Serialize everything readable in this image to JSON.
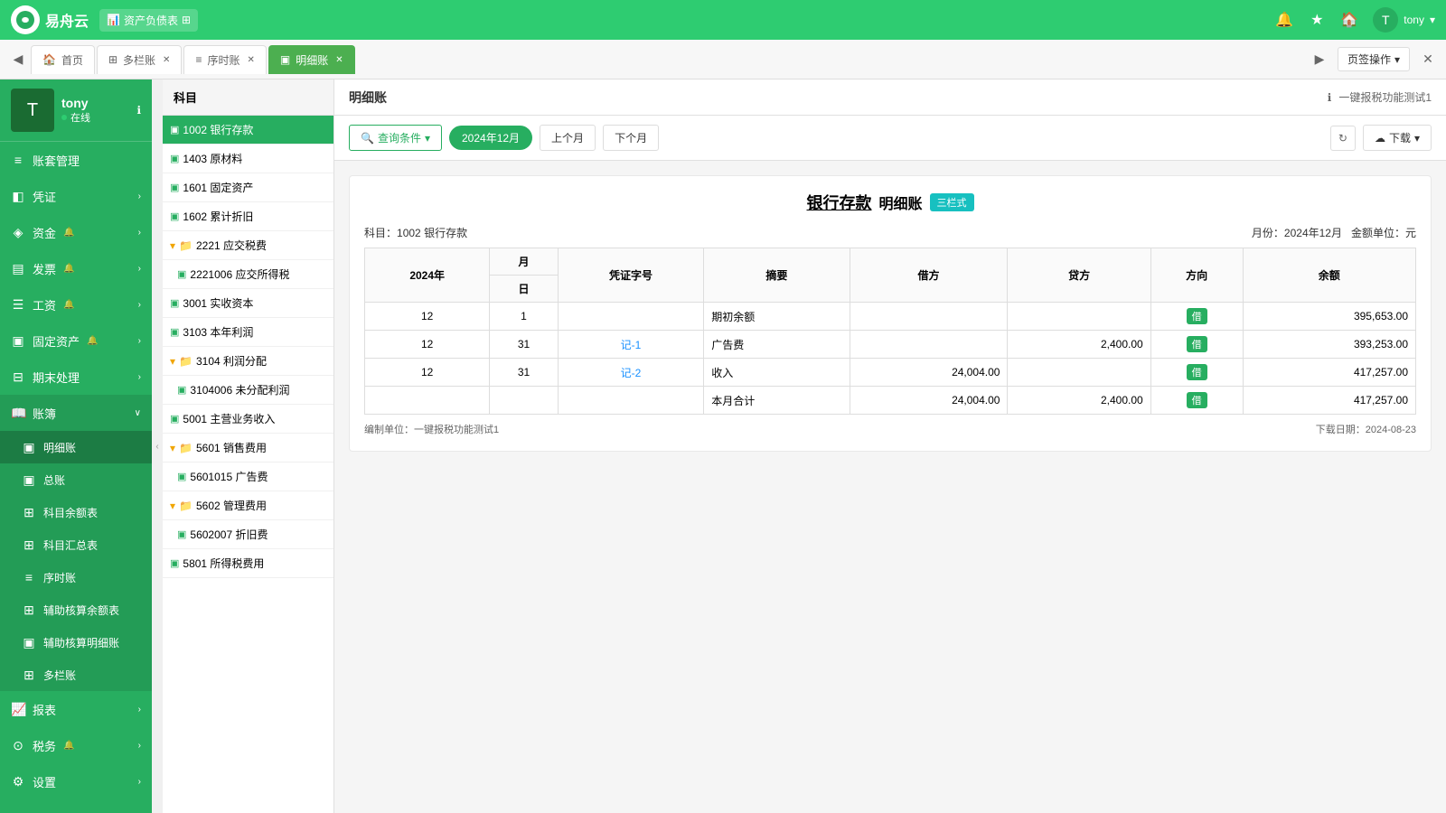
{
  "topbar": {
    "logo_text": "易舟云",
    "breadcrumb": "资产负债表",
    "user": "tony",
    "icons": [
      "bell",
      "star",
      "bookmark",
      "user"
    ]
  },
  "tabs": [
    {
      "id": "home",
      "label": "首页",
      "icon": "🏠",
      "closable": false,
      "active": false
    },
    {
      "id": "multicolumn",
      "label": "多栏账",
      "icon": "⊞",
      "closable": true,
      "active": false
    },
    {
      "id": "sequence",
      "label": "序时账",
      "icon": "≡",
      "closable": true,
      "active": false
    },
    {
      "id": "detail",
      "label": "明细账",
      "icon": "▣",
      "closable": true,
      "active": true
    }
  ],
  "page_action": "页签操作",
  "sidebar": {
    "user": {
      "name": "tony",
      "status": "在线"
    },
    "menu": [
      {
        "id": "accounts",
        "label": "账套管理",
        "icon": "≡",
        "hasArrow": false
      },
      {
        "id": "voucher",
        "label": "凭证",
        "icon": "◧",
        "hasArrow": true
      },
      {
        "id": "capital",
        "label": "资金",
        "icon": "◈",
        "hasArrow": true
      },
      {
        "id": "invoice",
        "label": "发票",
        "icon": "▤",
        "hasArrow": true
      },
      {
        "id": "salary",
        "label": "工资",
        "icon": "☰",
        "hasArrow": true
      },
      {
        "id": "assets",
        "label": "固定资产",
        "icon": "▣",
        "hasArrow": true
      },
      {
        "id": "period",
        "label": "期末处理",
        "icon": "⊟",
        "hasArrow": true
      },
      {
        "id": "ledger",
        "label": "账簿",
        "icon": "📖",
        "hasArrow": false,
        "open": true
      },
      {
        "id": "report",
        "label": "报表",
        "icon": "📈",
        "hasArrow": true
      },
      {
        "id": "tax",
        "label": "税务",
        "icon": "⊙",
        "hasArrow": true
      },
      {
        "id": "settings",
        "label": "设置",
        "icon": "⚙",
        "hasArrow": true
      }
    ],
    "submenu": [
      {
        "id": "detail_ledger",
        "label": "明细账",
        "active": true
      },
      {
        "id": "general_ledger",
        "label": "总账"
      },
      {
        "id": "balance_subject",
        "label": "科目余额表"
      },
      {
        "id": "subject_summary",
        "label": "科目汇总表"
      },
      {
        "id": "journal",
        "label": "序时账"
      },
      {
        "id": "aux_balance",
        "label": "辅助核算余额表"
      },
      {
        "id": "aux_detail",
        "label": "辅助核算明细账"
      },
      {
        "id": "multi_col",
        "label": "多栏账"
      }
    ]
  },
  "subject_panel": {
    "header": "科目",
    "items": [
      {
        "code": "1002",
        "name": "银行存款",
        "level": 0,
        "active": true
      },
      {
        "code": "1403",
        "name": "原材料",
        "level": 0,
        "active": false
      },
      {
        "code": "1601",
        "name": "固定资产",
        "level": 0,
        "active": false
      },
      {
        "code": "1602",
        "name": "累计折旧",
        "level": 0,
        "active": false
      },
      {
        "code": "2221",
        "name": "应交税费",
        "level": 0,
        "folder": true,
        "active": false
      },
      {
        "code": "2221006",
        "name": "应交所得税",
        "level": 1,
        "active": false
      },
      {
        "code": "3001",
        "name": "实收资本",
        "level": 0,
        "active": false
      },
      {
        "code": "3103",
        "name": "本年利润",
        "level": 0,
        "active": false
      },
      {
        "code": "3104",
        "name": "利润分配",
        "level": 0,
        "folder": true,
        "active": false
      },
      {
        "code": "3104006",
        "name": "未分配利润",
        "level": 1,
        "active": false
      },
      {
        "code": "5001",
        "name": "主营业务收入",
        "level": 0,
        "active": false
      },
      {
        "code": "5601",
        "name": "销售费用",
        "level": 0,
        "folder": true,
        "active": false
      },
      {
        "code": "5601015",
        "name": "广告费",
        "level": 1,
        "active": false
      },
      {
        "code": "5602",
        "name": "管理费用",
        "level": 0,
        "folder": true,
        "active": false
      },
      {
        "code": "5602007",
        "name": "折旧费",
        "level": 1,
        "active": false
      },
      {
        "code": "5801",
        "name": "所得税费用",
        "level": 0,
        "active": false
      }
    ]
  },
  "page": {
    "title": "明细账",
    "one_click_label": "一键报税功能测试1"
  },
  "toolbar": {
    "query_label": "查询条件",
    "current_month": "2024年12月",
    "prev_month": "上个月",
    "next_month": "下个月",
    "download_label": "下载"
  },
  "ledger": {
    "title1": "银行存款",
    "title2": "明细账",
    "col_mode": "三栏式",
    "subject_no": "1002",
    "subject_name": "银行存款",
    "month": "2024年12月",
    "amount_unit": "金额单位：元",
    "columns": {
      "year": "2024年",
      "month": "月",
      "day": "日",
      "voucher_no": "凭证字号",
      "summary": "摘要",
      "debit": "借方",
      "credit": "贷方",
      "direction": "方向",
      "balance": "余额"
    },
    "rows": [
      {
        "month": "12",
        "day": "1",
        "voucher": "",
        "summary": "期初余额",
        "debit": "",
        "credit": "",
        "direction": "借",
        "balance": "395,653.00"
      },
      {
        "month": "12",
        "day": "31",
        "voucher": "记-1",
        "summary": "广告费",
        "debit": "",
        "credit": "2,400.00",
        "direction": "借",
        "balance": "393,253.00"
      },
      {
        "month": "12",
        "day": "31",
        "voucher": "记-2",
        "summary": "收入",
        "debit": "24,004.00",
        "credit": "",
        "direction": "借",
        "balance": "417,257.00"
      },
      {
        "month": "",
        "day": "",
        "voucher": "",
        "summary": "本月合计",
        "debit": "24,004.00",
        "credit": "2,400.00",
        "direction": "借",
        "balance": "417,257.00"
      }
    ],
    "footer_company": "编制单位：一键报税功能测试1",
    "footer_date": "下载日期：2024-08-23"
  }
}
